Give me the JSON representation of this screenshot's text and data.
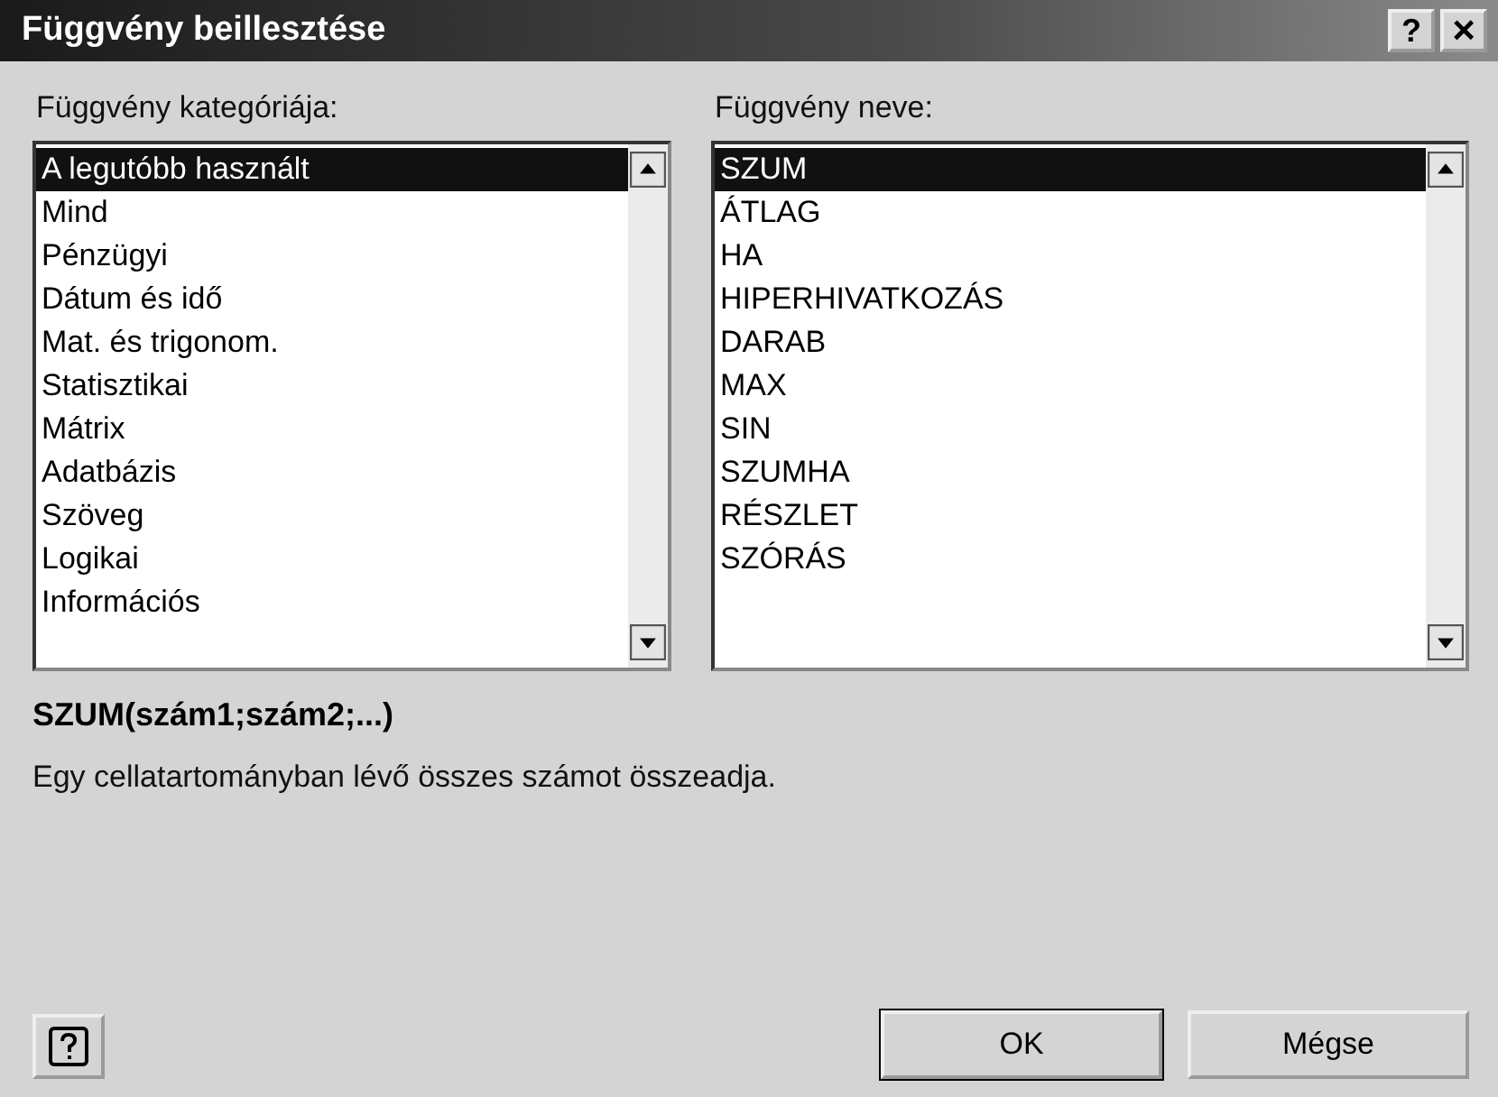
{
  "window": {
    "title": "Függvény beillesztése",
    "title_buttons": [
      {
        "kind": "help",
        "label": "?"
      },
      {
        "kind": "close",
        "label": "×"
      }
    ]
  },
  "category_list": {
    "label": "Függvény kategóriája:",
    "items": [
      {
        "label": "A legutóbb használt",
        "selected": true
      },
      {
        "label": "Mind",
        "selected": false
      },
      {
        "label": "Pénzügyi",
        "selected": false
      },
      {
        "label": "Dátum és idő",
        "selected": false
      },
      {
        "label": "Mat. és trigonom.",
        "selected": false
      },
      {
        "label": "Statisztikai",
        "selected": false
      },
      {
        "label": "Mátrix",
        "selected": false
      },
      {
        "label": "Adatbázis",
        "selected": false
      },
      {
        "label": "Szöveg",
        "selected": false
      },
      {
        "label": "Logikai",
        "selected": false
      },
      {
        "label": "Információs",
        "selected": false
      }
    ]
  },
  "function_list": {
    "label": "Függvény neve:",
    "items": [
      {
        "label": "SZUM",
        "selected": true
      },
      {
        "label": "ÁTLAG",
        "selected": false
      },
      {
        "label": "HA",
        "selected": false
      },
      {
        "label": "HIPERHIVATKOZÁS",
        "selected": false
      },
      {
        "label": "DARAB",
        "selected": false
      },
      {
        "label": "MAX",
        "selected": false
      },
      {
        "label": "SIN",
        "selected": false
      },
      {
        "label": "SZUMHA",
        "selected": false
      },
      {
        "label": "RÉSZLET",
        "selected": false
      },
      {
        "label": "SZÓRÁS",
        "selected": false
      }
    ]
  },
  "syntax": "SZUM(szám1;szám2;...)",
  "description": "Egy cellatartományban lévő összes számot összeadja.",
  "buttons": [
    {
      "label": "OK",
      "default": true
    },
    {
      "label": "Mégse",
      "default": false
    }
  ]
}
